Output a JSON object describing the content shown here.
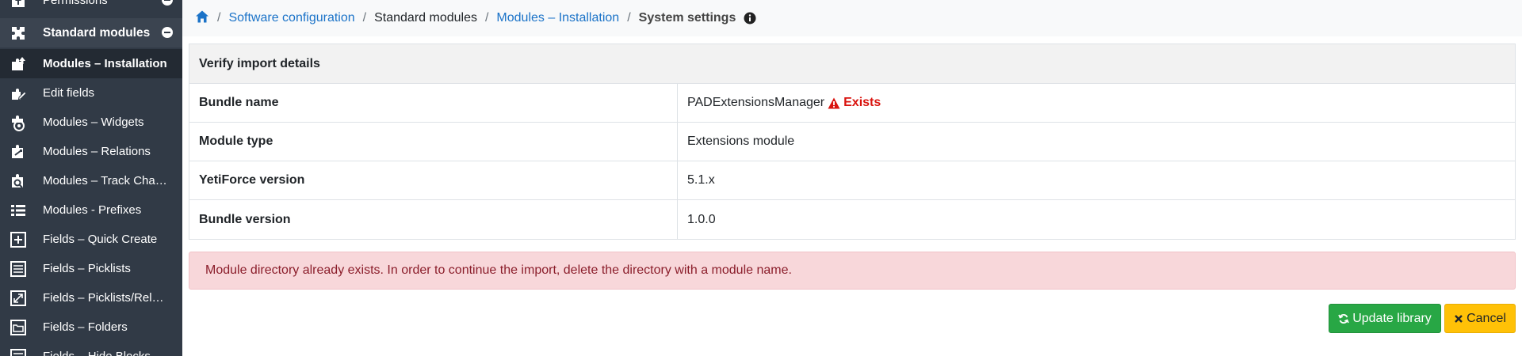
{
  "sidebar": {
    "items": [
      {
        "label": "Permissions",
        "icon": "permissions-icon"
      },
      {
        "label": "Standard modules",
        "icon": "puzzle-icon",
        "section": true
      },
      {
        "label": "Modules – Installation",
        "icon": "module-upload-icon",
        "active": true
      },
      {
        "label": "Edit fields",
        "icon": "edit-fields-icon"
      },
      {
        "label": "Modules – Widgets",
        "icon": "widgets-icon"
      },
      {
        "label": "Modules – Relations",
        "icon": "relations-icon"
      },
      {
        "label": "Modules – Track Changes",
        "icon": "track-changes-icon"
      },
      {
        "label": "Modules - Prefixes",
        "icon": "prefixes-icon"
      },
      {
        "label": "Fields – Quick Create",
        "icon": "quick-create-icon"
      },
      {
        "label": "Fields – Picklists",
        "icon": "picklist-icon"
      },
      {
        "label": "Fields – Picklists/Relations",
        "icon": "picklist-relations-icon"
      },
      {
        "label": "Fields – Folders",
        "icon": "folder-icon"
      },
      {
        "label": "Fields – Hide Blocks",
        "icon": "hide-blocks-icon"
      }
    ]
  },
  "breadcrumb": {
    "software_configuration": "Software configuration",
    "standard_modules": "Standard modules",
    "modules_installation": "Modules – Installation",
    "system_settings": "System settings"
  },
  "panel": {
    "title": "Verify import details",
    "rows": [
      {
        "label": "Bundle name",
        "value": "PADExtensionsManager",
        "badge": "Exists"
      },
      {
        "label": "Module type",
        "value": "Extensions module"
      },
      {
        "label": "YetiForce version",
        "value": "5.1.x"
      },
      {
        "label": "Bundle version",
        "value": "1.0.0"
      }
    ]
  },
  "alert": {
    "message": "Module directory already exists. In order to continue the import, delete the directory with a module name."
  },
  "actions": {
    "update_label": "Update library",
    "cancel_label": "Cancel"
  },
  "colors": {
    "sidebar_bg": "#313a46",
    "link": "#1b73c8",
    "danger": "#d9140f",
    "success": "#28a745",
    "warning": "#ffc107"
  }
}
